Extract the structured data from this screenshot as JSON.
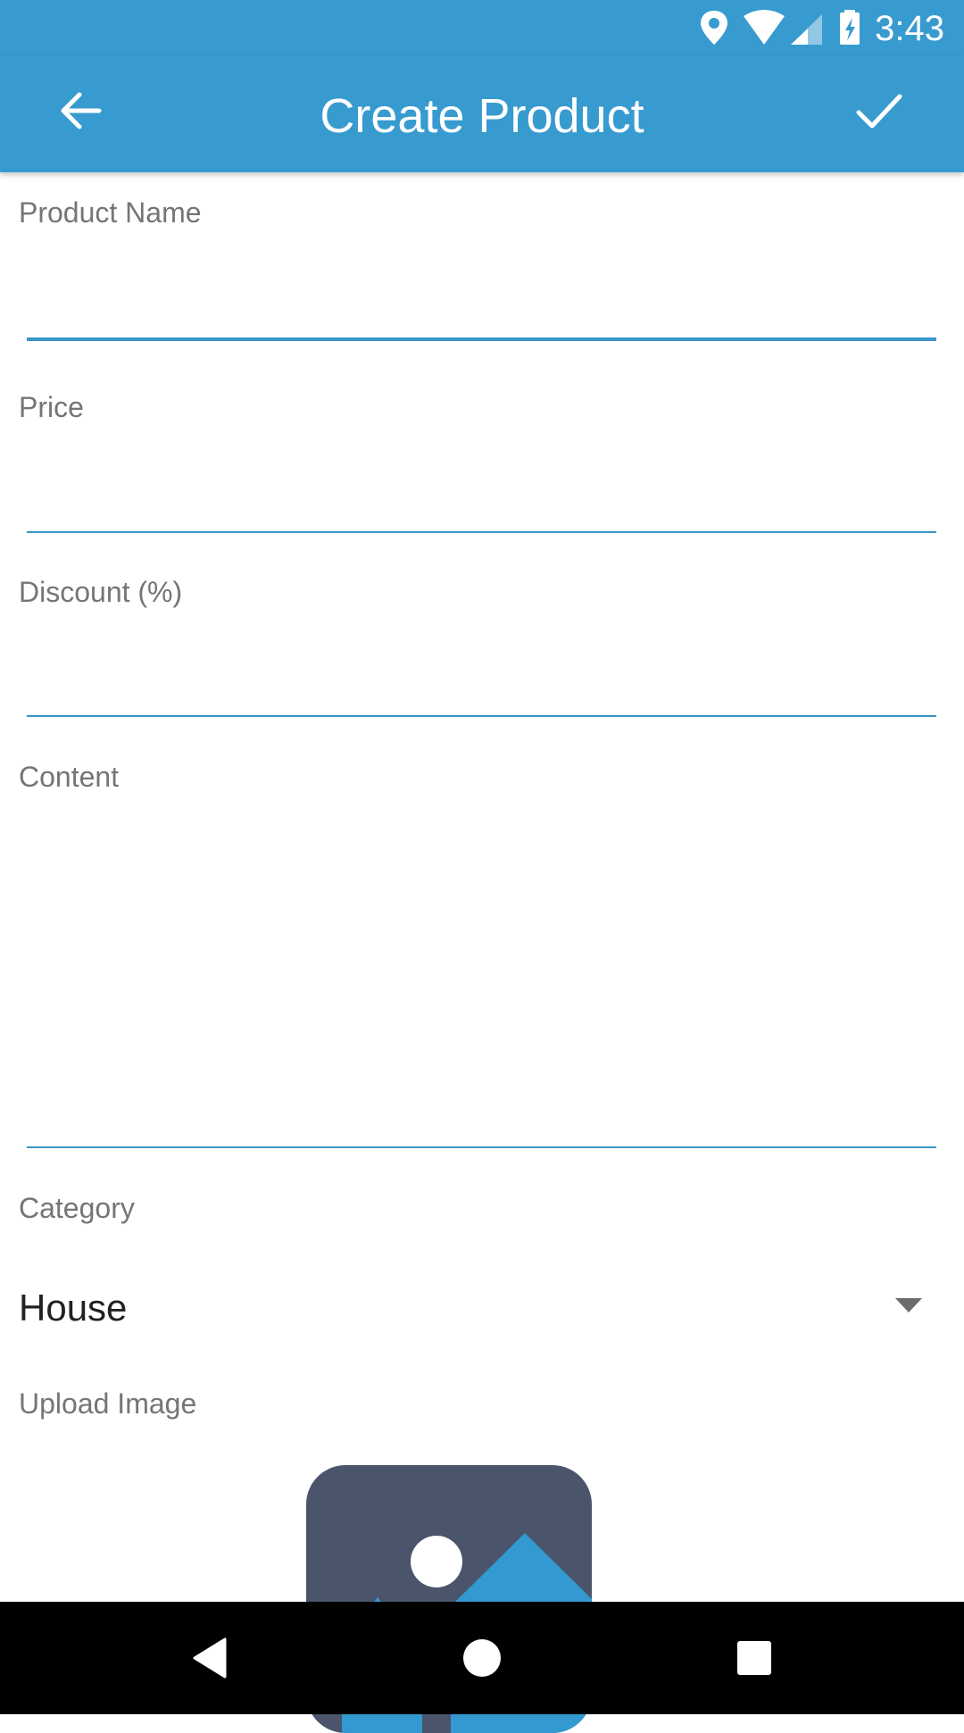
{
  "status_bar": {
    "time": "3:43",
    "icons": [
      "location-icon",
      "wifi-icon",
      "signal-icon",
      "battery-charging-icon"
    ]
  },
  "app_bar": {
    "title": "Create Product",
    "back_icon": "arrow-left-icon",
    "confirm_icon": "checkmark-icon"
  },
  "form": {
    "product_name": {
      "label": "Product Name",
      "value": ""
    },
    "price": {
      "label": "Price",
      "value": ""
    },
    "discount": {
      "label": "Discount (%)",
      "value": ""
    },
    "content": {
      "label": "Content",
      "value": ""
    },
    "category": {
      "label": "Category",
      "value": "House"
    },
    "upload_image": {
      "label": "Upload Image",
      "icon": "image-placeholder-icon"
    }
  },
  "nav_bar": {
    "icons": [
      "back-triangle-icon",
      "home-circle-icon",
      "recents-square-icon"
    ]
  },
  "colors": {
    "primary": "#389bcf",
    "accent_underline": "#3a95c8",
    "label_gray": "#757575",
    "image_box": "#4a556c"
  }
}
